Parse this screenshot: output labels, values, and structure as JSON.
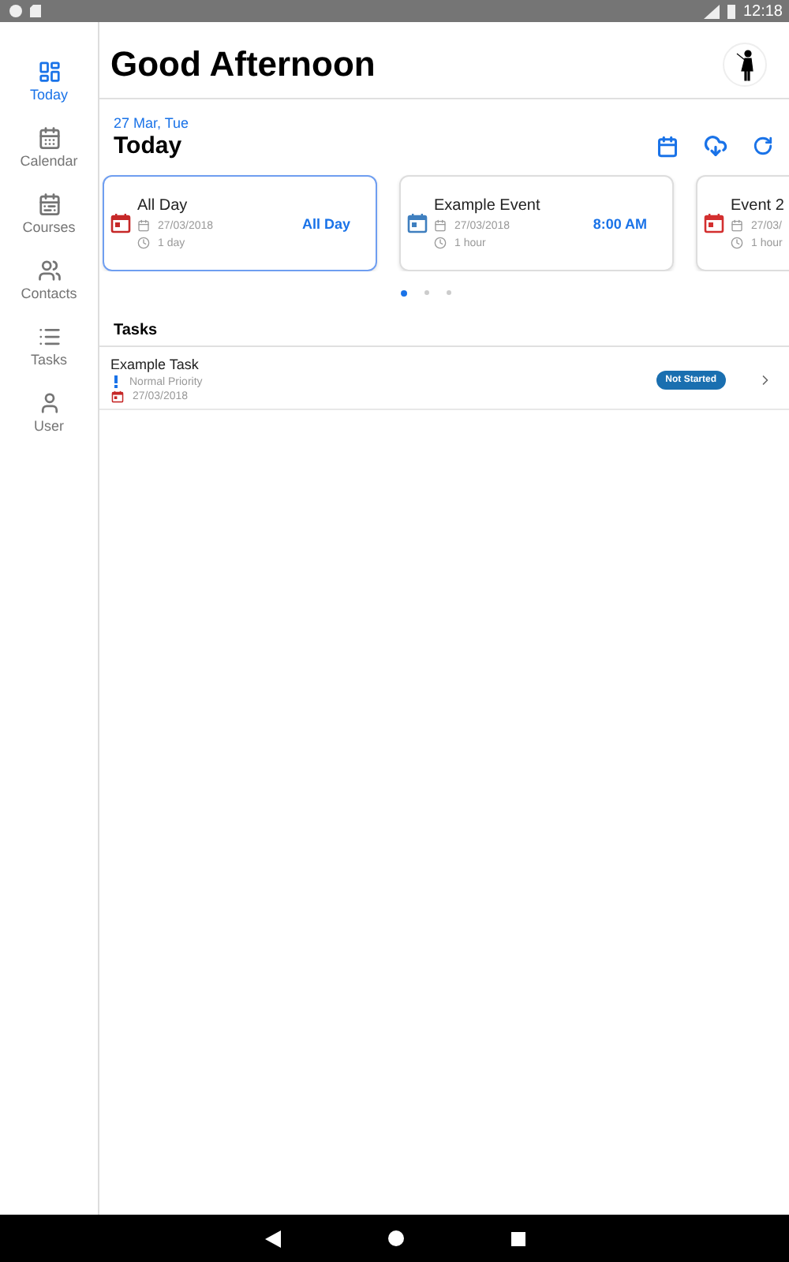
{
  "status_bar": {
    "time": "12:18"
  },
  "sidebar": {
    "items": [
      {
        "label": "Today",
        "selected": true
      },
      {
        "label": "Calendar",
        "selected": false
      },
      {
        "label": "Courses",
        "selected": false
      },
      {
        "label": "Contacts",
        "selected": false
      },
      {
        "label": "Tasks",
        "selected": false
      },
      {
        "label": "User",
        "selected": false
      }
    ]
  },
  "header": {
    "greeting": "Good Afternoon"
  },
  "today": {
    "date": "27 Mar, Tue",
    "title": "Today",
    "events": [
      {
        "title": "All Day",
        "date": "27/03/2018",
        "duration": "1 day",
        "time": "All Day",
        "color": "#c62828",
        "selected": true
      },
      {
        "title": "Example Event",
        "date": "27/03/2018",
        "duration": "1 hour",
        "time": "8:00 AM",
        "color": "#3f7fbf",
        "selected": false
      },
      {
        "title": "Event 2",
        "date": "27/03/",
        "duration": "1 hour",
        "color": "#d32f2f",
        "selected": false
      }
    ],
    "pages": [
      {
        "selected": true
      },
      {
        "selected": false
      },
      {
        "selected": false
      }
    ]
  },
  "tasks": {
    "title": "Tasks",
    "items": [
      {
        "name": "Example Task",
        "priority": "Normal Priority",
        "date": "27/03/2018",
        "status": "Not Started"
      }
    ]
  }
}
